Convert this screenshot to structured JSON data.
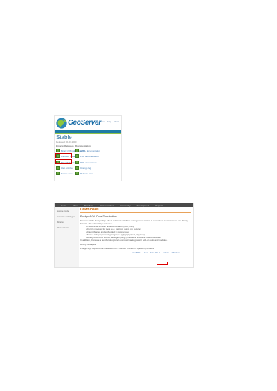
{
  "geoserver": {
    "name": "GeoServer",
    "nav": [
      "home",
      "help",
      "about"
    ],
    "title": "Stable",
    "subtitle": "Released: 01.03.2010",
    "col_left": "Binaries/Releases",
    "col_right": "Documentation",
    "left_items": [
      "Binary (OS independent)",
      "Windows Installer",
      "Mac OS X Installer",
      "Web Archive",
      "Source code"
    ],
    "right_items": [
      "HTML documentation",
      "PDF documentation",
      "PDF user manual",
      "Change log",
      "Release notes"
    ],
    "colors": {
      "brand": "#1b6ea8",
      "rule": "#1f7ca5",
      "icon": "#6aa640",
      "highlight": "#cc0000"
    }
  },
  "downloads": {
    "nav": [
      "Home",
      "About",
      "Download",
      "Documentation",
      "Community",
      "Development",
      "Support"
    ],
    "sidebar": [
      "Source Code",
      "Software Catalogue",
      "Binaries",
      "Old Versions"
    ],
    "title": "Downloads",
    "subtitle": "PostgreSQL Core Distribution",
    "intro": "The core of the PostgreSQL object-relational database management system is available in several source and binary formats. The full package includes:",
    "bullets": [
      "The core server with all documentation (html, man)",
      "Contrib modules for tools (e.g. psql, pg_dump, pg_restore)",
      "Client libraries and embedded C preprocessor",
      "Server-side programming languages (plpgsql, plperl, plpython)",
      "Ready to compile source packages (tar.gz), installers, and other useful software"
    ],
    "note": "In addition, there are a number of optional download packages with add-on tools and modules.",
    "binary_label": "Binary packages",
    "compat": "PostgreSQL supports the installation on a number of different operating systems.",
    "links": [
      "FreeBSD",
      "Linux",
      "Mac OS X",
      "Solaris",
      "Windows"
    ],
    "colors": {
      "title": "#c8650a",
      "bar": "#e8a25a",
      "highlight": "#dd0000"
    }
  },
  "page_number": ""
}
